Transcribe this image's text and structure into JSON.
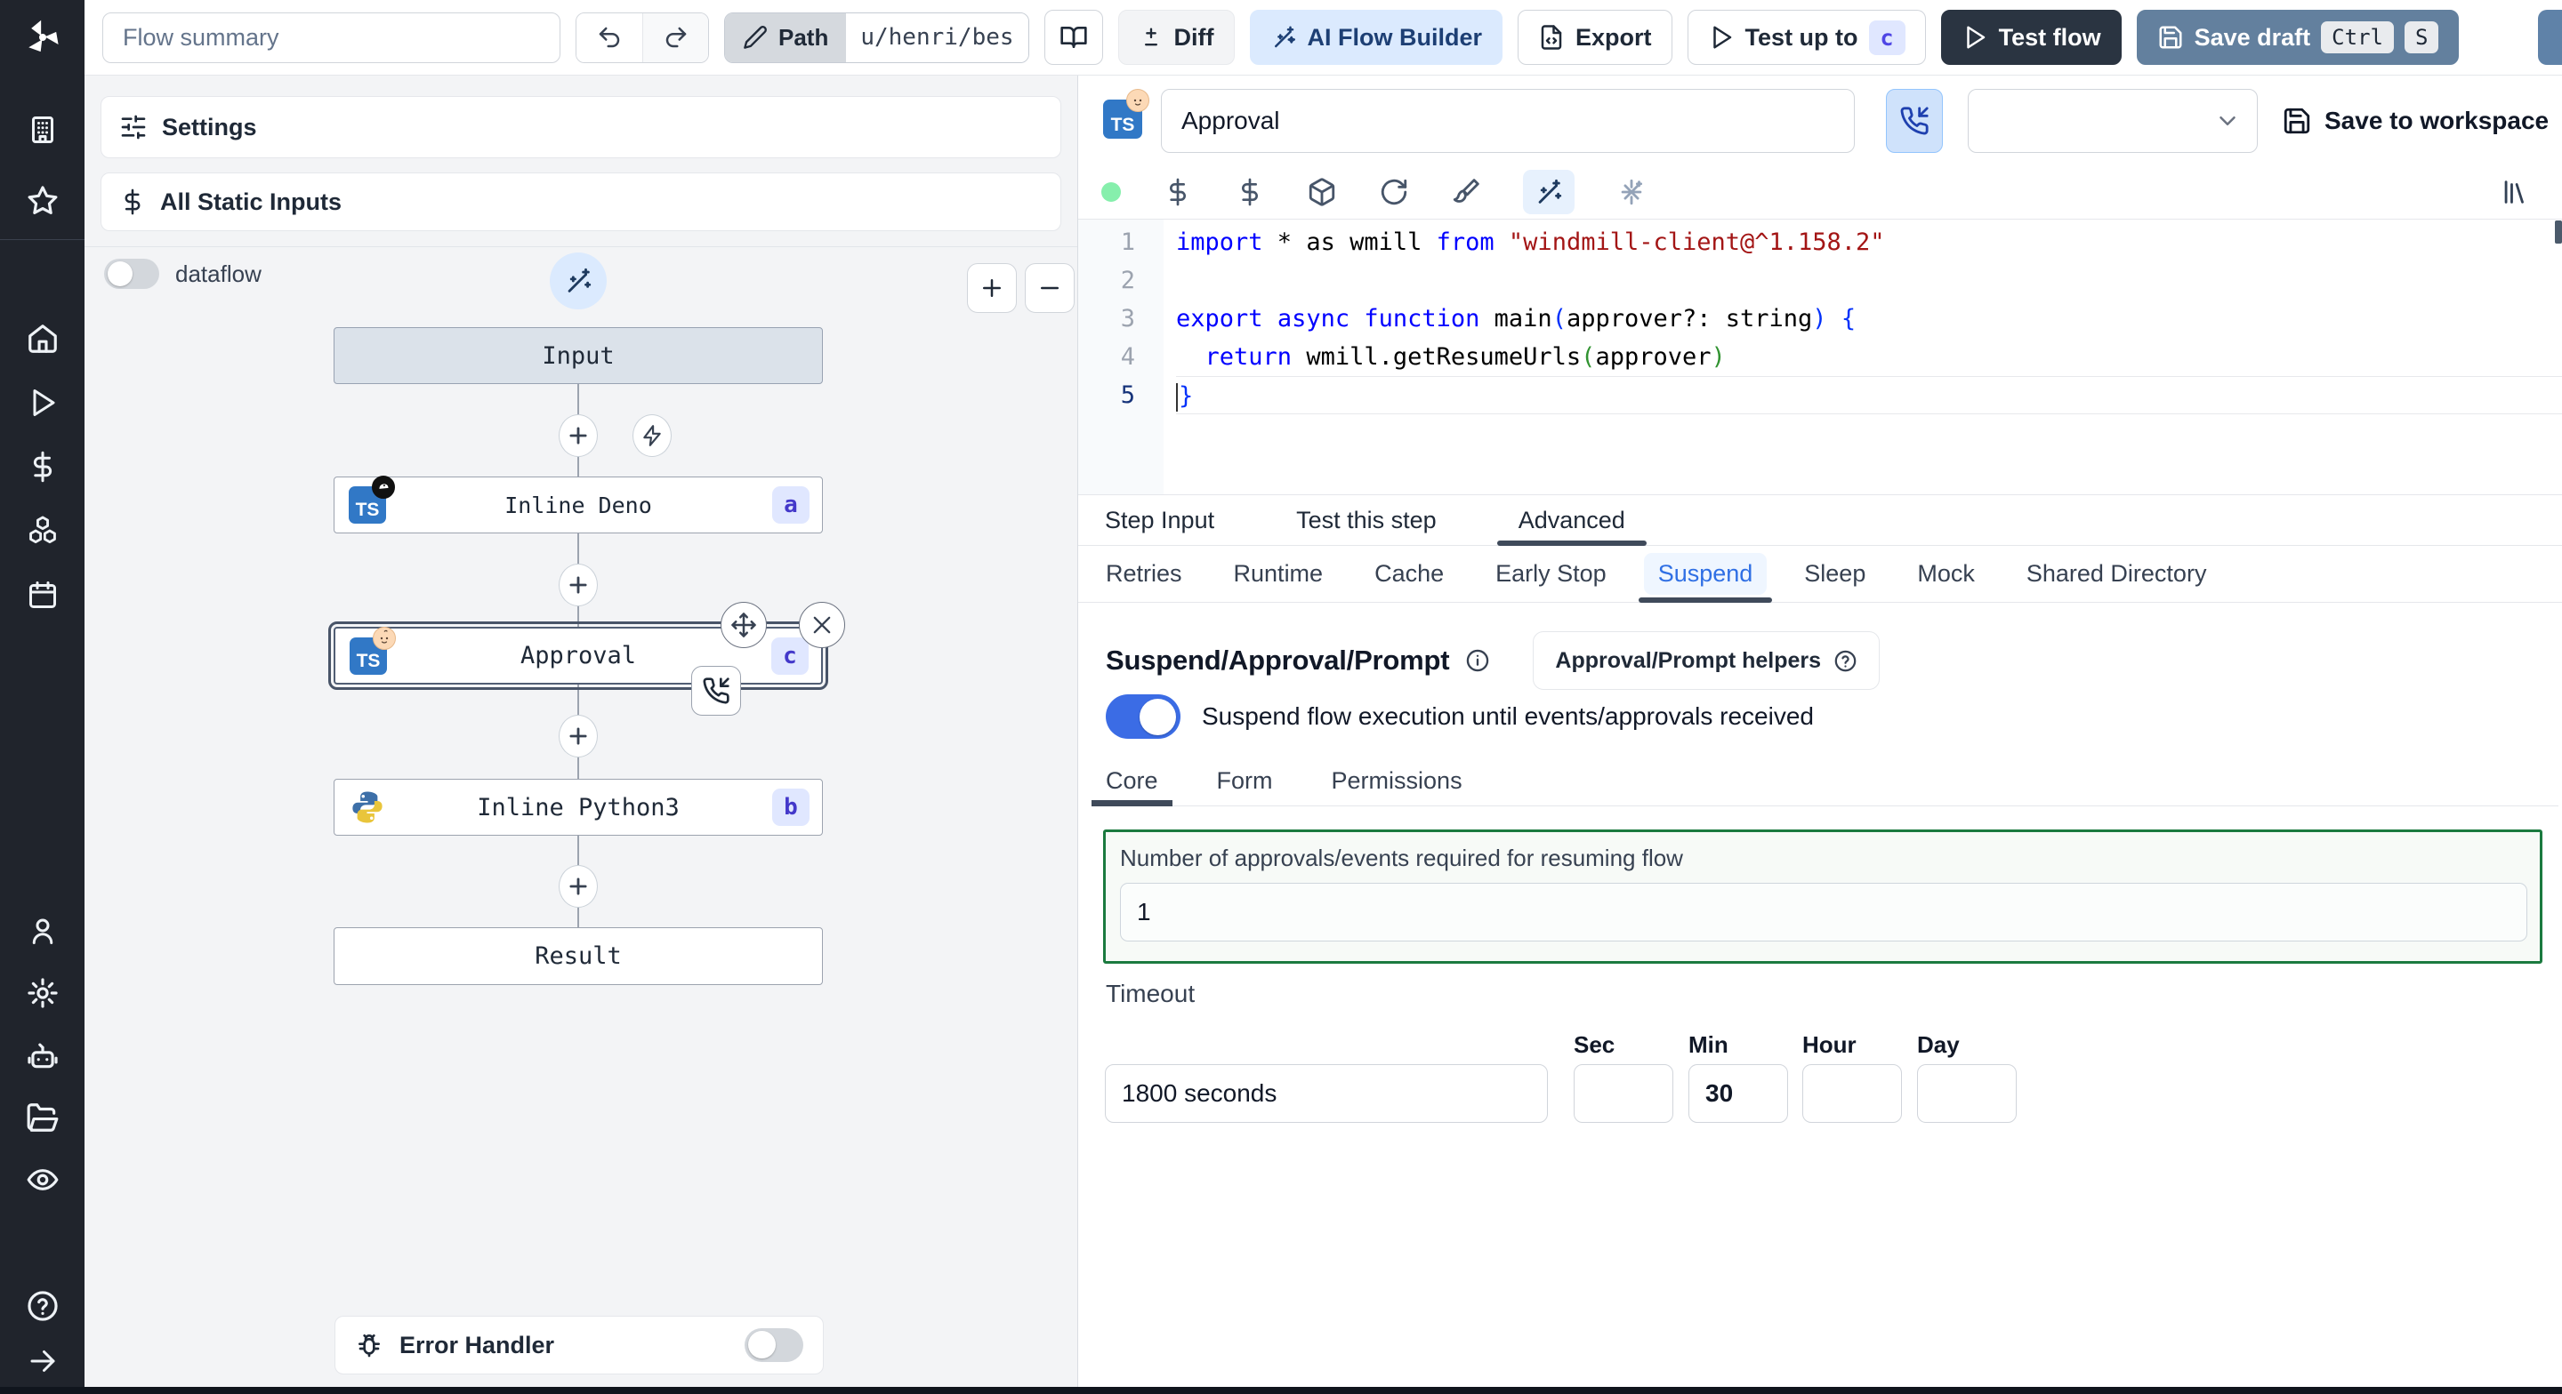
{
  "topbar": {
    "flow_summary_placeholder": "Flow summary",
    "path_label": "Path",
    "path_value": "u/henri/bes",
    "diff_label": "Diff",
    "ai_builder_label": "AI Flow Builder",
    "export_label": "Export",
    "test_up_to_label": "Test up to",
    "test_up_to_badge": "c",
    "test_flow_label": "Test flow",
    "save_draft_label": "Save draft",
    "kbd_ctrl": "Ctrl",
    "kbd_s": "S"
  },
  "sidebar": {
    "icons": [
      "building",
      "star",
      "home",
      "play",
      "dollar",
      "boxes",
      "calendar",
      "user",
      "settings",
      "bot",
      "folder",
      "eye",
      "help-circle",
      "collapse-arrow"
    ]
  },
  "graph": {
    "settings_label": "Settings",
    "static_inputs_label": "All Static Inputs",
    "dataflow_label": "dataflow",
    "nodes": {
      "input": {
        "label": "Input"
      },
      "deno": {
        "label": "Inline Deno",
        "badge": "a",
        "icon": "typescript-deno"
      },
      "approval": {
        "label": "Approval",
        "badge": "c",
        "icon": "typescript-approval"
      },
      "python": {
        "label": "Inline Python3",
        "badge": "b",
        "icon": "python"
      },
      "result": {
        "label": "Result"
      }
    },
    "error_handler_label": "Error Handler"
  },
  "editor": {
    "line_numbers": [
      "1",
      "2",
      "3",
      "4",
      "5"
    ],
    "active_line": 5,
    "lines": [
      [
        {
          "t": "import",
          "c": "kw"
        },
        {
          "t": " * as wmill ",
          "c": "pl"
        },
        {
          "t": "from",
          "c": "kw"
        },
        {
          "t": " ",
          "c": "pl"
        },
        {
          "t": "\"windmill-client@^1.158.2\"",
          "c": "str"
        }
      ],
      [],
      [
        {
          "t": "export",
          "c": "kw"
        },
        {
          "t": " ",
          "c": "pl"
        },
        {
          "t": "async",
          "c": "kw"
        },
        {
          "t": " ",
          "c": "pl"
        },
        {
          "t": "function",
          "c": "kw"
        },
        {
          "t": " main",
          "c": "pl"
        },
        {
          "t": "(",
          "c": "b1"
        },
        {
          "t": "approver?: string",
          "c": "pl"
        },
        {
          "t": ")",
          "c": "b1"
        },
        {
          "t": " ",
          "c": "pl"
        },
        {
          "t": "{",
          "c": "b1"
        }
      ],
      [
        {
          "t": "  ",
          "c": "pl"
        },
        {
          "t": "return",
          "c": "kw"
        },
        {
          "t": " wmill.getResumeUrls",
          "c": "pl"
        },
        {
          "t": "(",
          "c": "b2"
        },
        {
          "t": "approver",
          "c": "pl"
        },
        {
          "t": ")",
          "c": "b2"
        }
      ],
      [
        {
          "t": "}",
          "c": "b1"
        }
      ]
    ]
  },
  "step": {
    "title_value": "Approval",
    "save_to_workspace_label": "Save to workspace",
    "tabs": [
      "Step Input",
      "Test this step",
      "Advanced"
    ],
    "active_tab": "Advanced",
    "subtabs": [
      "Retries",
      "Runtime",
      "Cache",
      "Early Stop",
      "Suspend",
      "Sleep",
      "Mock",
      "Shared Directory"
    ],
    "active_subtab": "Suspend",
    "suspend": {
      "heading": "Suspend/Approval/Prompt",
      "helpers_label": "Approval/Prompt helpers",
      "toggle_label": "Suspend flow execution until events/approvals received",
      "toggle_on": true,
      "tabs": [
        "Core",
        "Form",
        "Permissions"
      ],
      "active_tab": "Core",
      "approvals_label": "Number of approvals/events required for resuming flow",
      "approvals_value": "1",
      "timeout_label": "Timeout",
      "timeout_value": "1800 seconds",
      "units": [
        "Sec",
        "Min",
        "Hour",
        "Day"
      ],
      "sec_value": "",
      "min_value": "30",
      "hour_value": "",
      "day_value": ""
    }
  },
  "colors": {
    "accent_blue": "#3b6ce5",
    "suspend_tab_blue": "#2f6fe4",
    "approvals_border_green": "#1b7a3f",
    "badge_indigo_bg": "#e0e7ff",
    "badge_indigo_text": "#4338ca",
    "save_draft_steel": "#63809e",
    "test_flow_dark": "#2a3441",
    "status_dot_green": "#86efac"
  }
}
